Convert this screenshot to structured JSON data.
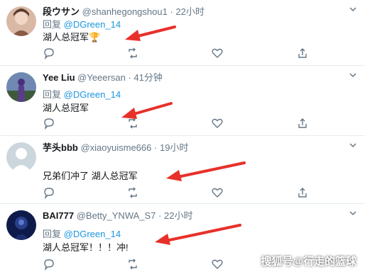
{
  "tweets": [
    {
      "name": "段ウサン",
      "handle": "@shanhegongshou1",
      "separator": "·",
      "time": "22小时",
      "reply_prefix": "回复",
      "reply_to": "@DGreen_14",
      "text": "湖人总冠军🏆"
    },
    {
      "name": "Yee Liu",
      "handle": "@Yeeersan",
      "separator": "·",
      "time": "41分钟",
      "reply_prefix": "回复",
      "reply_to": "@DGreen_14",
      "text": "湖人总冠军"
    },
    {
      "name": "芋头bbb",
      "handle": "@xiaoyuisme666",
      "separator": "·",
      "time": "19小时",
      "reply_prefix": "",
      "reply_to": "",
      "text": "兄弟们冲了 湖人总冠军"
    },
    {
      "name": "BAI777",
      "handle": "@Betty_YNWA_S7",
      "separator": "·",
      "time": "22小时",
      "reply_prefix": "回复",
      "reply_to": "@DGreen_14",
      "text": "湖人总冠军！！！冲!"
    }
  ],
  "icons": {
    "reply": "reply-icon",
    "retweet": "retweet-icon",
    "like": "heart-icon",
    "share": "share-icon",
    "more": "chevron-down-icon"
  },
  "colors": {
    "mention": "#1b95e0",
    "muted": "#657786",
    "arrow": "#e8302a",
    "divider": "#e6ecf0"
  },
  "watermark": "搜狐号@行走的篮球"
}
